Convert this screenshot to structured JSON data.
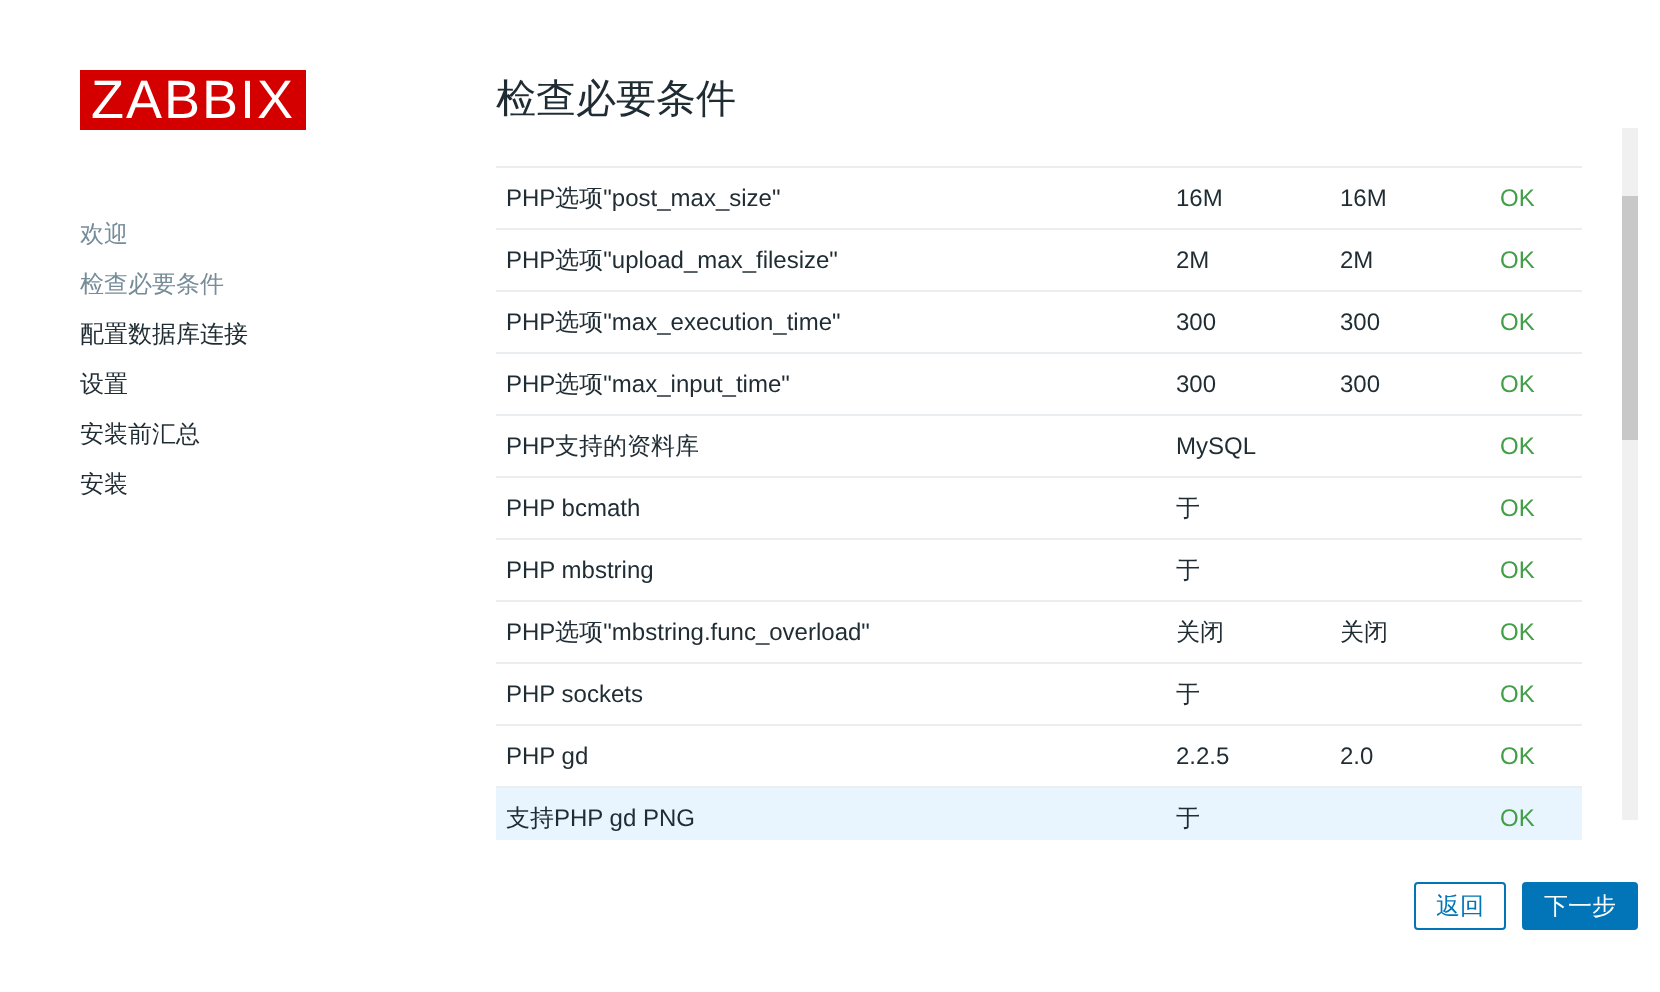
{
  "logo": "ZABBIX",
  "steps": [
    {
      "label": "欢迎",
      "completed": true
    },
    {
      "label": "检查必要条件",
      "completed": true
    },
    {
      "label": "配置数据库连接",
      "completed": false
    },
    {
      "label": "设置",
      "completed": false
    },
    {
      "label": "安装前汇总",
      "completed": false
    },
    {
      "label": "安装",
      "completed": false
    }
  ],
  "title": "检查必要条件",
  "requirements": [
    {
      "name": "PHP选项\"post_max_size\"",
      "current": "16M",
      "required": "16M",
      "status": "OK",
      "highlighted": false
    },
    {
      "name": "PHP选项\"upload_max_filesize\"",
      "current": "2M",
      "required": "2M",
      "status": "OK",
      "highlighted": false
    },
    {
      "name": "PHP选项\"max_execution_time\"",
      "current": "300",
      "required": "300",
      "status": "OK",
      "highlighted": false
    },
    {
      "name": "PHP选项\"max_input_time\"",
      "current": "300",
      "required": "300",
      "status": "OK",
      "highlighted": false
    },
    {
      "name": "PHP支持的资料库",
      "current": "MySQL",
      "status": "OK",
      "highlighted": false
    },
    {
      "name": "PHP bcmath",
      "current": "于",
      "status": "OK",
      "highlighted": false
    },
    {
      "name": "PHP mbstring",
      "current": "于",
      "status": "OK",
      "highlighted": false
    },
    {
      "name": "PHP选项\"mbstring.func_overload\"",
      "current": "关闭",
      "required": "关闭",
      "status": "OK",
      "highlighted": false
    },
    {
      "name": "PHP sockets",
      "current": "于",
      "status": "OK",
      "highlighted": false
    },
    {
      "name": "PHP gd",
      "current": "2.2.5",
      "required": "2.0",
      "status": "OK",
      "highlighted": false
    },
    {
      "name": "支持PHP gd PNG",
      "current": "于",
      "status": "OK",
      "highlighted": true
    }
  ],
  "buttons": [
    {
      "label": "返回",
      "kind": "secondary"
    },
    {
      "label": "下一步",
      "kind": "primary"
    }
  ]
}
